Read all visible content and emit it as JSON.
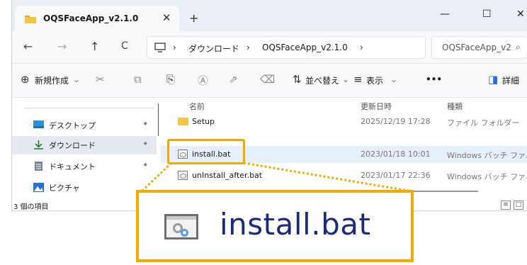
{
  "window": {
    "tab_title": "OQSFaceApp_v2.1.0",
    "tab_close": "✕",
    "new_tab": "+",
    "minimize": "—",
    "maximize": "☐",
    "close": "✕"
  },
  "navigation": {
    "back": "←",
    "forward": "→",
    "up": "↑",
    "refresh": "C",
    "breadcrumbs": [
      "ダウンロード",
      "OQSFaceApp_v2.1.0"
    ],
    "separator": "›",
    "search_placeholder": "OQSFaceApp_v2",
    "search_icon": "🔍"
  },
  "toolbar": {
    "new_label": "新規作成",
    "new_icon": "⊕",
    "cut_icon": "✂",
    "copy_icon": "⧉",
    "paste_icon": "📋",
    "rename_icon": "Ⓐ",
    "share_icon": "⇗",
    "delete_icon": "🗑",
    "sort_label": "並べ替え",
    "sort_icon": "⇅",
    "view_label": "表示",
    "view_icon": "≡",
    "more": "•••",
    "details_label": "詳細",
    "details_icon": "◨",
    "dropdown": "⌄"
  },
  "sidebar": {
    "items": [
      {
        "label": "デスクトップ",
        "icon": "desktop-icon",
        "color": "#2e8fd6"
      },
      {
        "label": "ダウンロード",
        "icon": "download-icon",
        "color": "#2a7a3b"
      },
      {
        "label": "ドキュメント",
        "icon": "document-icon",
        "color": "#7a8696"
      },
      {
        "label": "ピクチャ",
        "icon": "picture-icon",
        "color": "#2d6fd3"
      }
    ],
    "pin": "📌"
  },
  "filelist": {
    "columns": [
      "名前",
      "更新日時",
      "種類"
    ],
    "rows": [
      {
        "name": "Setup",
        "date": "2025/12/19 17:28",
        "type": "ファイル フォルダー",
        "kind": "folder"
      },
      {
        "name": "install.bat",
        "date": "2023/01/18 10:01",
        "type": "Windows バッチ ファ...",
        "kind": "bat"
      },
      {
        "name": "unInstall_after.bat",
        "date": "2023/01/17 22:36",
        "type": "Windows バッチ ファ...",
        "kind": "bat"
      }
    ]
  },
  "status": {
    "item_count": "3 個の項目"
  },
  "callout": {
    "zoom_text": "install.bat",
    "highlight_color": "#f2a900"
  }
}
